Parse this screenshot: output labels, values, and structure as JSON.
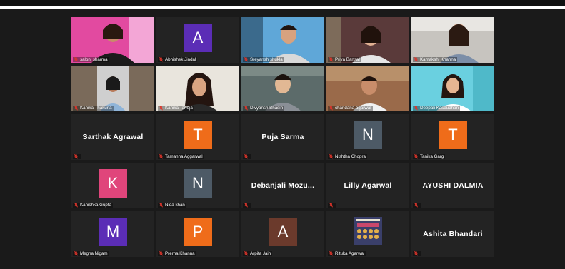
{
  "colors": {
    "active_border": "#d9e64d",
    "tile_bg": "#232323",
    "stage_bg": "#1a1a1a"
  },
  "participants": [
    {
      "name": "saloni sharma",
      "kind": "video",
      "active": true
    },
    {
      "name": "Abhishek Jindal",
      "kind": "avatar",
      "initial": "A",
      "color": "#5b2db6"
    },
    {
      "name": "Sreyansh shukla",
      "kind": "video"
    },
    {
      "name": "Priya Bansal",
      "kind": "video"
    },
    {
      "name": "Kamakshi Khanna",
      "kind": "video"
    },
    {
      "name": "Kanika Thakuria",
      "kind": "video"
    },
    {
      "name": "Kanika Taneja",
      "kind": "video"
    },
    {
      "name": "Divyansh Bhasin",
      "kind": "video"
    },
    {
      "name": "chandana agarwal",
      "kind": "video"
    },
    {
      "name": "Deepali Kasaudhan",
      "kind": "video"
    },
    {
      "name": "Sarthak Agrawal",
      "kind": "text",
      "label": ""
    },
    {
      "name": "Tamanna Aggarwal",
      "kind": "avatar",
      "initial": "T",
      "color": "#ef6c1a"
    },
    {
      "name": "Puja Sarma",
      "kind": "text",
      "label": ""
    },
    {
      "name": "Nishtha Chopra",
      "kind": "avatar",
      "initial": "N",
      "color": "#4d5a66"
    },
    {
      "name": "Tanika Garg",
      "kind": "avatar",
      "initial": "T",
      "color": "#ef6c1a"
    },
    {
      "name": "Kanishka Gupta",
      "kind": "avatar",
      "initial": "K",
      "color": "#e0457b"
    },
    {
      "name": "Nida khan",
      "kind": "avatar",
      "initial": "N",
      "color": "#4d5a66"
    },
    {
      "name": "Debanjali  Mozu...",
      "kind": "text",
      "label": ""
    },
    {
      "name": "Lilly Agarwal",
      "kind": "text",
      "label": ""
    },
    {
      "name": "AYUSHI DALMIA",
      "kind": "text",
      "label": ""
    },
    {
      "name": "Megha Nigam",
      "kind": "avatar",
      "initial": "M",
      "color": "#5b2db6"
    },
    {
      "name": "Prerna Khanna",
      "kind": "avatar",
      "initial": "P",
      "color": "#ef6c1a"
    },
    {
      "name": "Arpita Jain",
      "kind": "avatar",
      "initial": "A",
      "color": "#6b3a2c"
    },
    {
      "name": "Rituka Agarwal",
      "kind": "poster"
    },
    {
      "name": "Ashita Bhandari",
      "kind": "text",
      "label": ""
    }
  ]
}
